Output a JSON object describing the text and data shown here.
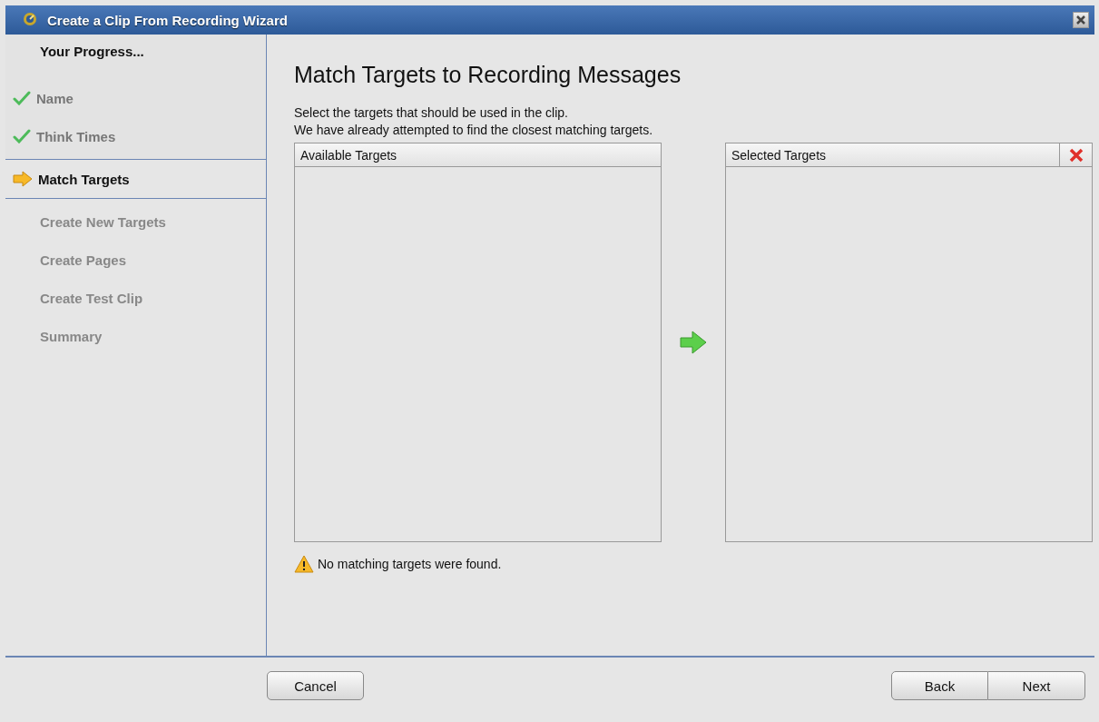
{
  "window": {
    "title": "Create a Clip From Recording Wizard"
  },
  "progress": {
    "heading": "Your Progress...",
    "steps": [
      {
        "label": "Name",
        "kind": "done"
      },
      {
        "label": "Think Times",
        "kind": "done"
      },
      {
        "label": "Match Targets",
        "kind": "current"
      },
      {
        "label": "Create New Targets",
        "kind": "pending"
      },
      {
        "label": "Create Pages",
        "kind": "pending"
      },
      {
        "label": "Create Test Clip",
        "kind": "pending"
      },
      {
        "label": "Summary",
        "kind": "pending"
      }
    ]
  },
  "page": {
    "heading": "Match Targets to Recording Messages",
    "description": [
      "Select the targets that should be used in the clip.",
      "We have already attempted to find the closest matching targets."
    ],
    "available": {
      "header": "Available Targets"
    },
    "selected": {
      "header": "Selected Targets"
    },
    "warning": "No matching targets were found."
  },
  "buttons": {
    "cancel": "Cancel",
    "back": "Back",
    "next": "Next"
  }
}
